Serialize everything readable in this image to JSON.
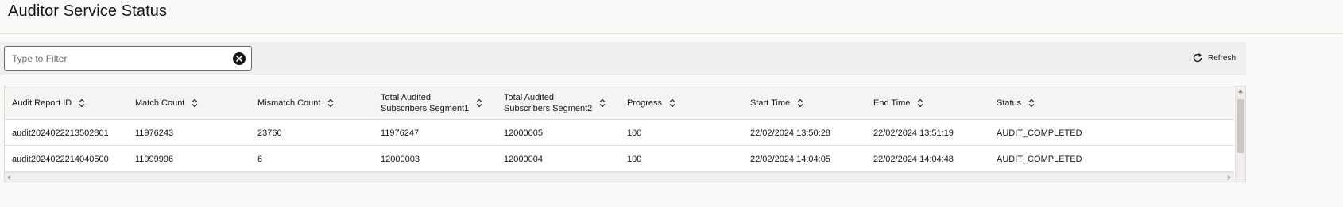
{
  "page": {
    "title": "Auditor Service Status"
  },
  "toolbar": {
    "filter_placeholder": "Type to Filter",
    "filter_value": "",
    "clear_icon": "clear-circle-icon",
    "refresh_label": "Refresh",
    "refresh_icon": "refresh-icon"
  },
  "table": {
    "columns": [
      {
        "line1": "Audit Report ID",
        "line2": ""
      },
      {
        "line1": "Match Count",
        "line2": ""
      },
      {
        "line1": "Mismatch Count",
        "line2": ""
      },
      {
        "line1": "Total Audited",
        "line2": "Subscribers Segment1"
      },
      {
        "line1": "Total Audited",
        "line2": "Subscribers Segment2"
      },
      {
        "line1": "Progress",
        "line2": ""
      },
      {
        "line1": "Start Time",
        "line2": ""
      },
      {
        "line1": "End Time",
        "line2": ""
      },
      {
        "line1": "Status",
        "line2": ""
      }
    ],
    "rows": [
      [
        "audit2024022213502801",
        "11976243",
        "23760",
        "11976247",
        "12000005",
        "100",
        "22/02/2024 13:50:28",
        "22/02/2024 13:51:19",
        "AUDIT_COMPLETED"
      ],
      [
        "audit2024022214040500",
        "11999996",
        "6",
        "12000003",
        "12000004",
        "100",
        "22/02/2024 14:04:05",
        "22/02/2024 14:04:48",
        "AUDIT_COMPLETED"
      ]
    ]
  },
  "colors": {
    "background": "#fbf9f8",
    "toolbar": "#f1efed",
    "header": "#f5f4f2",
    "text": "#161513"
  }
}
